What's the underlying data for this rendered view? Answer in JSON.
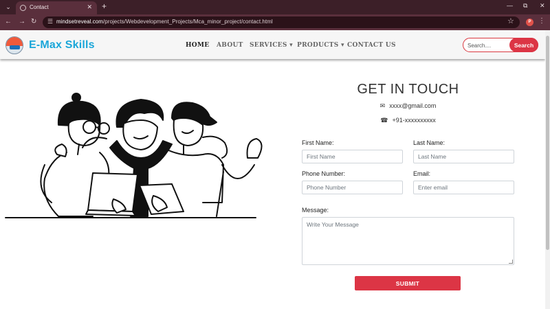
{
  "browser": {
    "tab_title": "Contact",
    "new_tab": "+",
    "url_host": "mindsetreveal.com",
    "url_path": "/projects/Webdevelopment_Projects/Mca_minor_project/contact.html",
    "profile_initial": "P"
  },
  "header": {
    "brand": "E-Max Skills",
    "nav": {
      "home": "HOME",
      "about": "ABOUT",
      "services": "SERVICES",
      "products": "PRODUCTS",
      "contact": "CONTACT US"
    },
    "search_placeholder": "Search....",
    "search_button": "Search"
  },
  "contact": {
    "title": "GET IN TOUCH",
    "email": "xxxx@gmail.com",
    "phone": "+91-xxxxxxxxxx",
    "first_name_label": "First Name:",
    "first_name_placeholder": "First Name",
    "last_name_label": "Last Name:",
    "last_name_placeholder": "Last Name",
    "phone_label": "Phone Number:",
    "phone_placeholder": "Phone Number",
    "email_label": "Email:",
    "email_placeholder": "Enter email",
    "message_label": "Message:",
    "message_placeholder": "Write Your Message",
    "submit": "SUBMIT"
  },
  "colors": {
    "brand": "#1aa6d9",
    "accent": "#dc3545",
    "tab_bar": "#3c1f28",
    "address_bar": "#5a2f3c"
  }
}
